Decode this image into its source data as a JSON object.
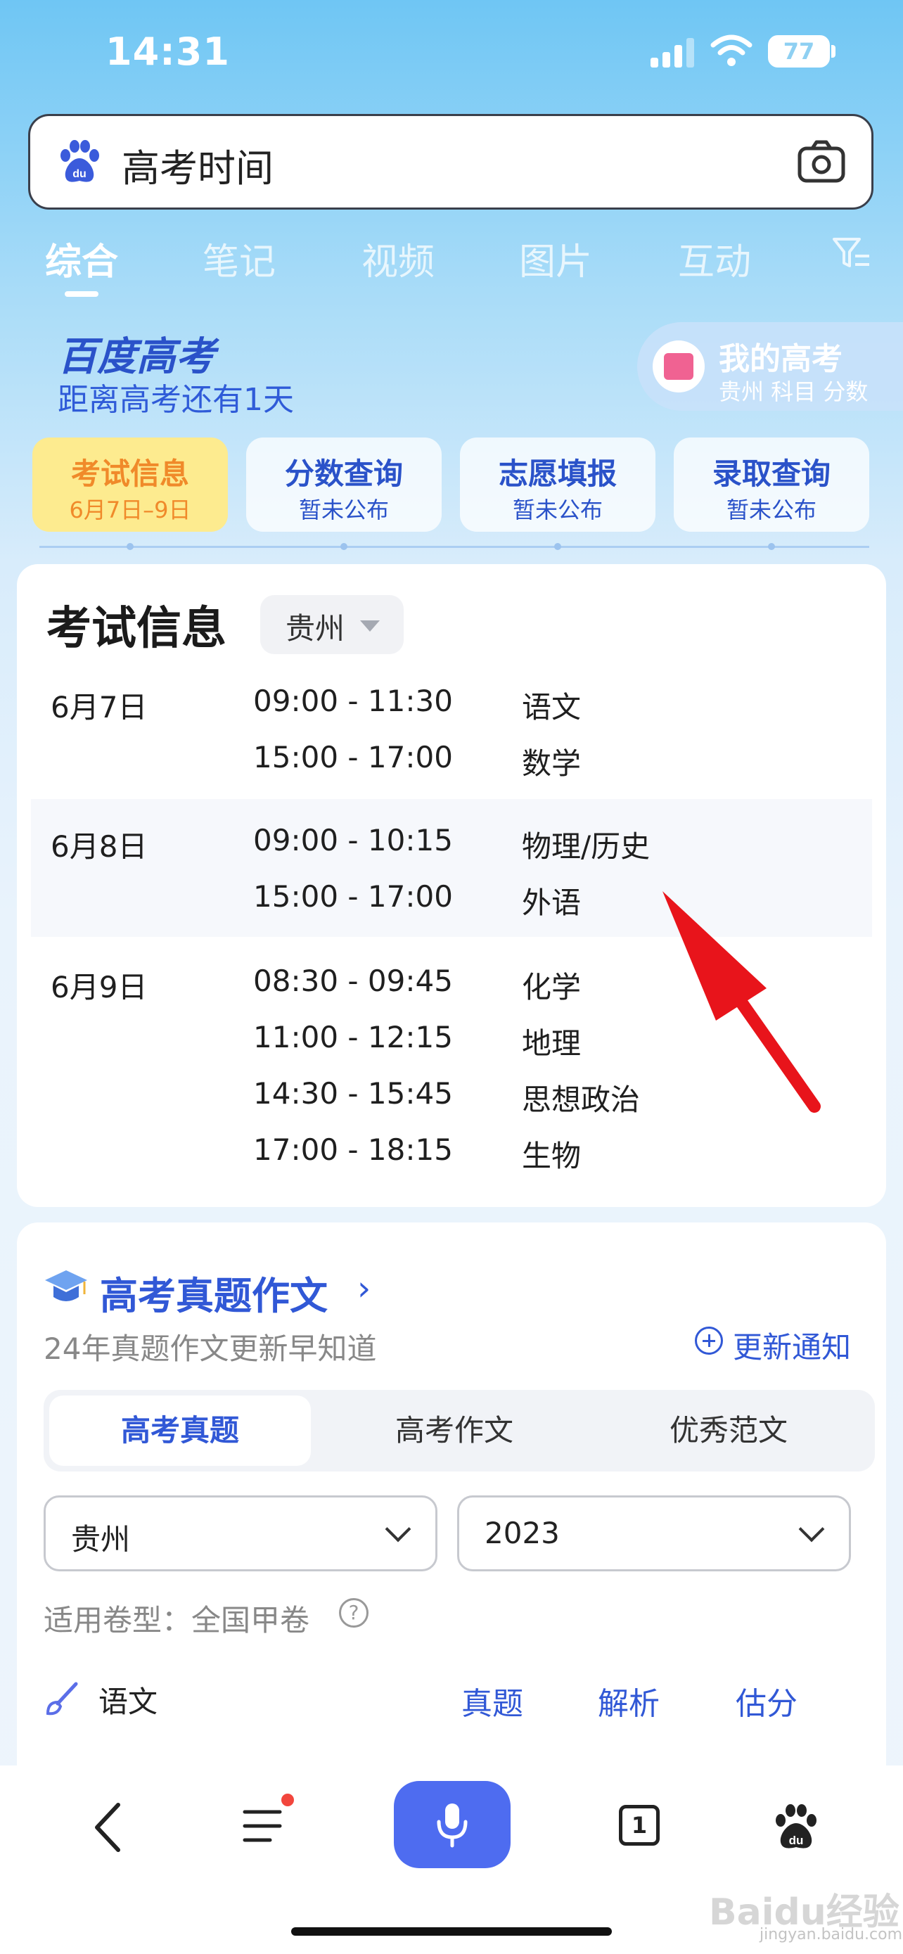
{
  "status_bar": {
    "time": "14:31",
    "battery": "77"
  },
  "search": {
    "query": "高考时间"
  },
  "tabs": [
    "综合",
    "笔记",
    "视频",
    "图片",
    "互动"
  ],
  "banner": {
    "brand": "百度高考",
    "countdown": "距离高考还有1天",
    "mine_title": "我的高考",
    "mine_sub": "贵州 科目 分数"
  },
  "quick_cards": [
    {
      "title": "考试信息",
      "sub": "6月7日–9日"
    },
    {
      "title": "分数查询",
      "sub": "暂未公布"
    },
    {
      "title": "志愿填报",
      "sub": "暂未公布"
    },
    {
      "title": "录取查询",
      "sub": "暂未公布"
    }
  ],
  "exam": {
    "title": "考试信息",
    "region": "贵州",
    "days": [
      {
        "date": "6月7日",
        "sessions": [
          {
            "time": "09:00 - 11:30",
            "subject": "语文"
          },
          {
            "time": "15:00 - 17:00",
            "subject": "数学"
          }
        ]
      },
      {
        "date": "6月8日",
        "sessions": [
          {
            "time": "09:00 - 10:15",
            "subject": "物理/历史"
          },
          {
            "time": "15:00 - 17:00",
            "subject": "外语"
          }
        ]
      },
      {
        "date": "6月9日",
        "sessions": [
          {
            "time": "08:30 - 09:45",
            "subject": "化学"
          },
          {
            "time": "11:00 - 12:15",
            "subject": "地理"
          },
          {
            "time": "14:30 - 15:45",
            "subject": "思想政治"
          },
          {
            "time": "17:00 - 18:15",
            "subject": "生物"
          }
        ]
      }
    ]
  },
  "essay": {
    "title": "高考真题作文",
    "subtitle": "24年真题作文更新早知道",
    "notify": "更新通知",
    "segments": [
      "高考真题",
      "高考作文",
      "优秀范文"
    ],
    "region": "贵州",
    "year": "2023",
    "paper_type": "适用卷型：全国甲卷",
    "subject": "语文",
    "links": [
      "真题",
      "解析",
      "估分"
    ]
  },
  "bottom": {
    "tabs_count": "1",
    "watermark": "Baidu经验",
    "watermark_url": "jingyan.baidu.com"
  },
  "colors": {
    "accent": "#3158d6",
    "mic": "#4e6cf0",
    "highlight": "#fdeb8f",
    "arrow": "#e8141b"
  }
}
